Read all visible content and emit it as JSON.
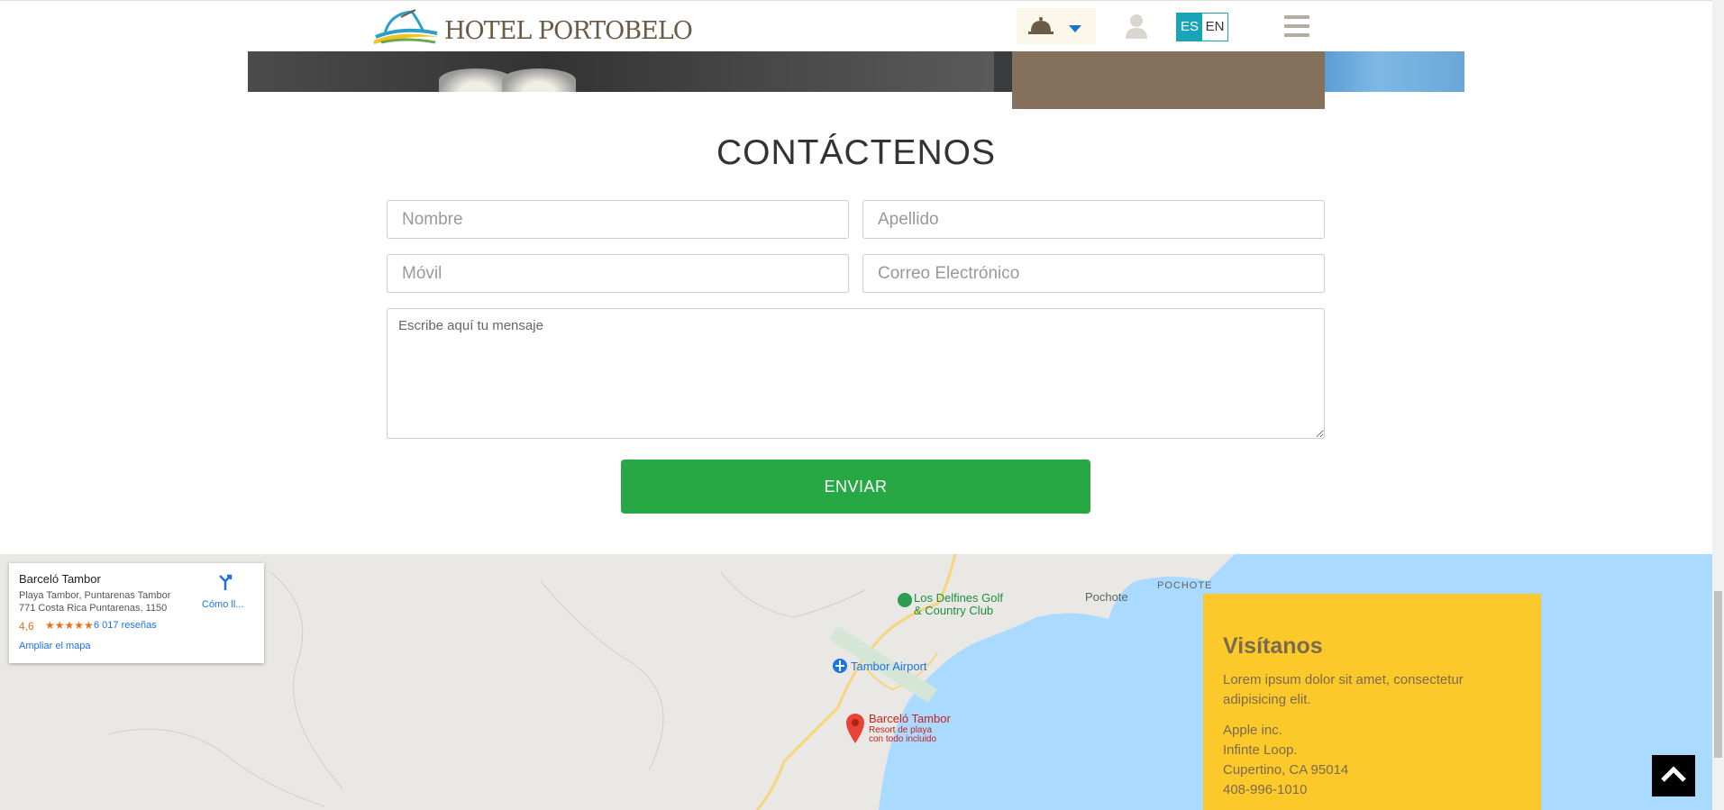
{
  "header": {
    "logo_text": "HOTEL PORTOBELO",
    "lang_es": "ES",
    "lang_en": "EN"
  },
  "contact": {
    "title": "CONTÁCTENOS",
    "first_name_placeholder": "Nombre",
    "last_name_placeholder": "Apellido",
    "mobile_placeholder": "Móvil",
    "email_placeholder": "Correo Electrónico",
    "message_placeholder": "Escribe aquí tu mensaje",
    "send_label": "ENVIAR"
  },
  "map": {
    "card": {
      "name": "Barceló Tambor",
      "address_line1": "Playa Tambor, Puntarenas Tambor",
      "address_line2": "771 Costa Rica Puntarenas, 1150",
      "rating": "4,6",
      "stars": "★★★★★",
      "reviews": "6 017 reseñas",
      "enlarge": "Ampliar el mapa",
      "directions": "Cómo ll..."
    },
    "places": {
      "golf_line1": "Los Delfines Golf",
      "golf_line2": "& Country Club",
      "pochote": "Pochote",
      "pochote_caps": "POCHOTE",
      "airport": "Tambor Airport",
      "resort_name": "Barceló Tambor",
      "resort_sub1": "Resort de playa",
      "resort_sub2": "con todo incluido"
    }
  },
  "visit": {
    "title": "Visítanos",
    "text": "Lorem ipsum dolor sit amet, consectetur adipisicing elit.",
    "company": "Apple inc.",
    "street": "Infinte Loop.",
    "city": "Cupertino, CA 95014",
    "phone": "408-996-1010"
  },
  "colors": {
    "send_button": "#28a745",
    "visit_card": "#fcc92b",
    "lang_accent": "#1aa4b7"
  }
}
